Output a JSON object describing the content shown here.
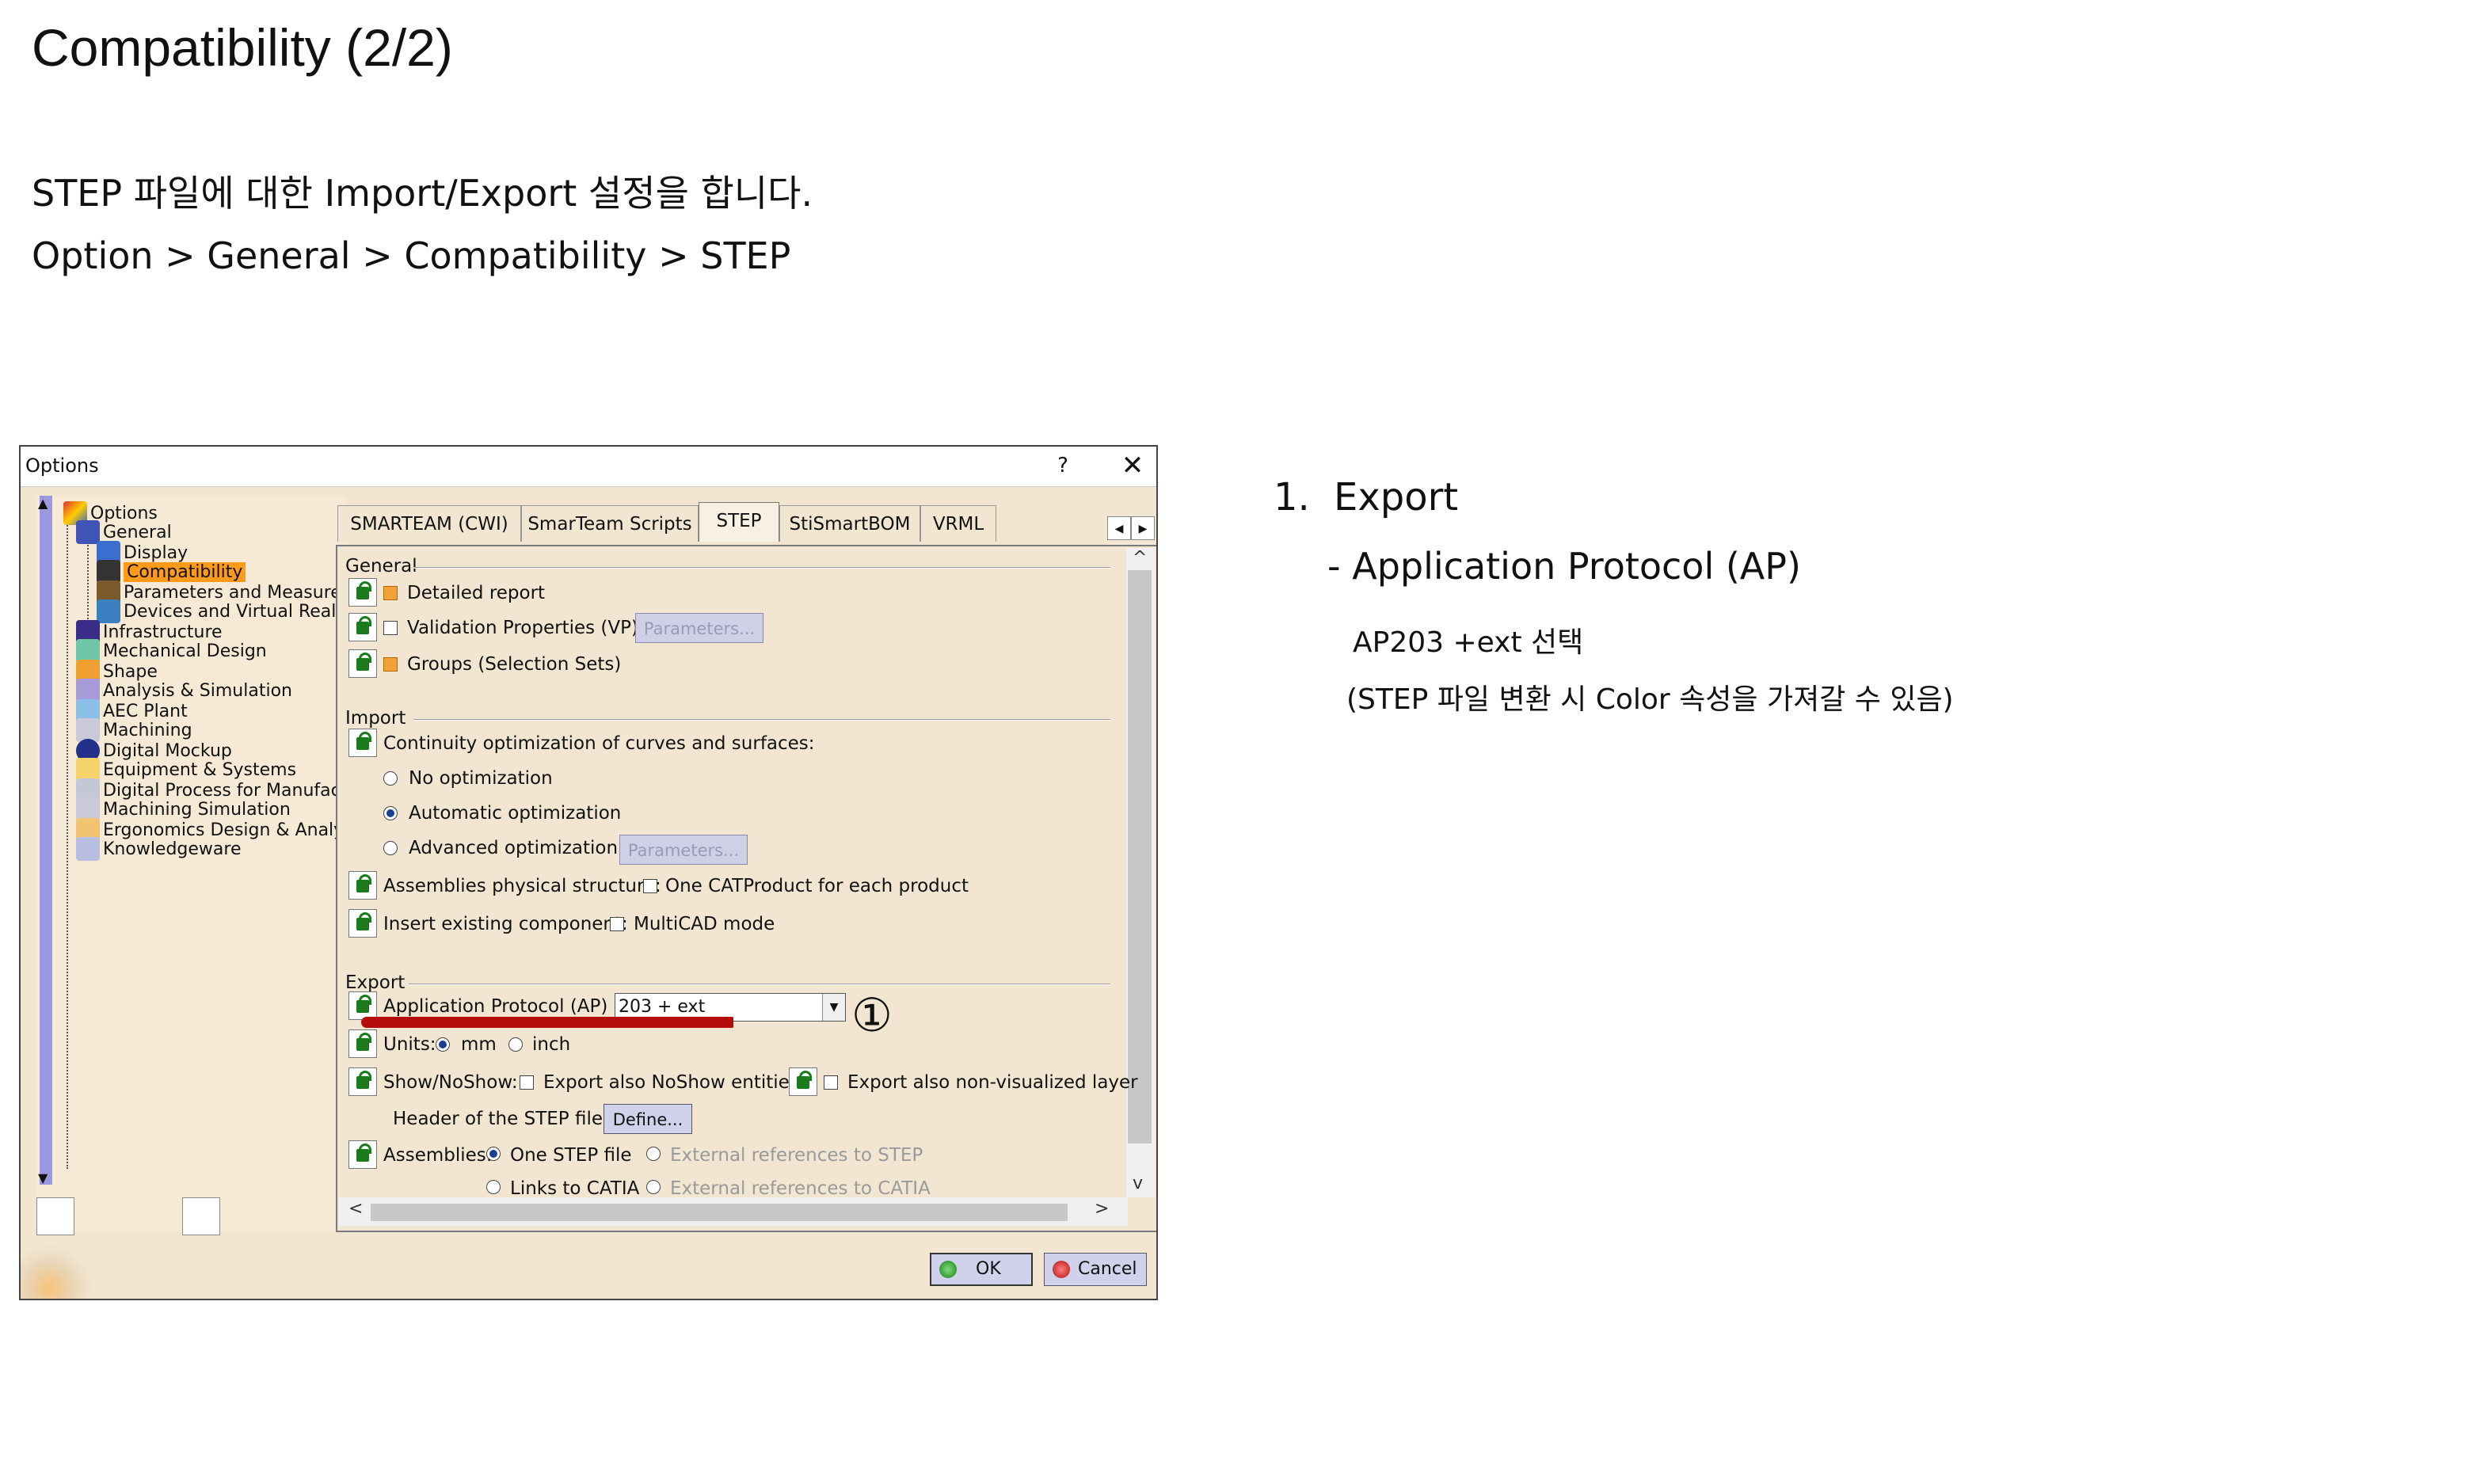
{
  "slide": {
    "title": "Compatibility (2/2)",
    "intro_line1": "STEP 파일에 대한 Import/Export 설정을 합니다.",
    "intro_line2": "Option > General > Compatibility > STEP"
  },
  "notes": {
    "number": "1.",
    "heading": "Export",
    "subheading": "- Application Protocol (AP)",
    "line1": "AP203 +ext 선택",
    "line2": "(STEP 파일 변환 시 Color 속성을 가져갈 수 있음)"
  },
  "dialog": {
    "title": "Options",
    "help_label": "?",
    "close_label": "✕",
    "ok_label": "OK",
    "cancel_label": "Cancel",
    "tree": {
      "root": "Options",
      "general": "General",
      "children": [
        "Display",
        "Compatibility",
        "Parameters and Measure",
        "Devices and Virtual Realit"
      ],
      "categories": [
        "Infrastructure",
        "Mechanical Design",
        "Shape",
        "Analysis & Simulation",
        "AEC Plant",
        "Machining",
        "Digital Mockup",
        "Equipment & Systems",
        "Digital Process for Manufact",
        "Machining Simulation",
        "Ergonomics Design & Analy",
        "Knowledgeware"
      ],
      "selected": "Compatibility"
    },
    "tabs": [
      "SMARTEAM (CWI)",
      "SmarTeam Scripts",
      "STEP",
      "StiSmartBOM",
      "VRML"
    ],
    "active_tab": "STEP",
    "general_section": {
      "label": "General",
      "detailed_report": "Detailed report",
      "validation": "Validation Properties (VP)",
      "groups": "Groups (Selection Sets)",
      "parameters_button": "Parameters..."
    },
    "import_section": {
      "label": "Import",
      "continuity": "Continuity optimization of curves and surfaces:",
      "no_opt": "No optimization",
      "auto_opt": "Automatic optimization",
      "adv_opt": "Advanced optimization",
      "parameters_button": "Parameters...",
      "assemblies_label": "Assemblies physical structure:",
      "assemblies_option": "One CATProduct for each product",
      "insert_label": "Insert existing component:",
      "insert_option": "MultiCAD mode"
    },
    "export_section": {
      "label": "Export",
      "ap_label": "Application Protocol (AP) :",
      "ap_value": "203 + ext",
      "units_label": "Units:",
      "unit_mm": "mm",
      "unit_inch": "inch",
      "showno_label": "Show/NoShow:",
      "showno_option": "Export also NoShow entities",
      "nonvis_option": "Export also non-visualized layer",
      "header_label": "Header of the STEP file :",
      "define_button": "Define...",
      "assemblies_label": "Assemblies:",
      "one_step": "One STEP file",
      "ext_refs": "External references to STEP",
      "links_catia": "Links to CATIA",
      "ext_refs_catia": "External references to CATIA"
    },
    "annotation": "①"
  }
}
